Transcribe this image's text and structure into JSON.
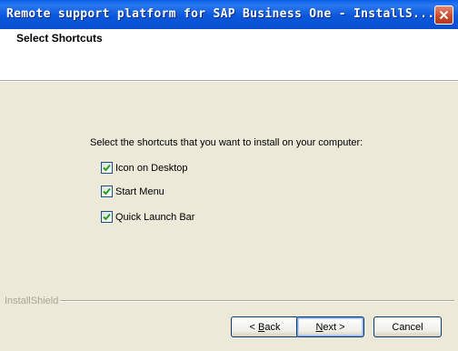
{
  "window": {
    "title": "Remote support platform for SAP Business One - InstallS..."
  },
  "header": {
    "title": "Select Shortcuts"
  },
  "main": {
    "prompt": "Select the shortcuts that you want to install on your computer:",
    "options": [
      {
        "label": "Icon on Desktop",
        "checked": true
      },
      {
        "label": "Start Menu",
        "checked": true
      },
      {
        "label": "Quick Launch Bar",
        "checked": true
      }
    ]
  },
  "footer": {
    "brand": "InstallShield",
    "back": {
      "mnemonic": "B",
      "rest": "ack",
      "prefix": "< "
    },
    "next": {
      "mnemonic": "N",
      "rest": "ext",
      "suffix": " >"
    },
    "cancel": "Cancel"
  },
  "colors": {
    "titlebar": "#0a5fe8",
    "face": "#ece9d8",
    "check": "#21a121"
  },
  "icons": [
    "close-icon",
    "checkmark-icon"
  ]
}
